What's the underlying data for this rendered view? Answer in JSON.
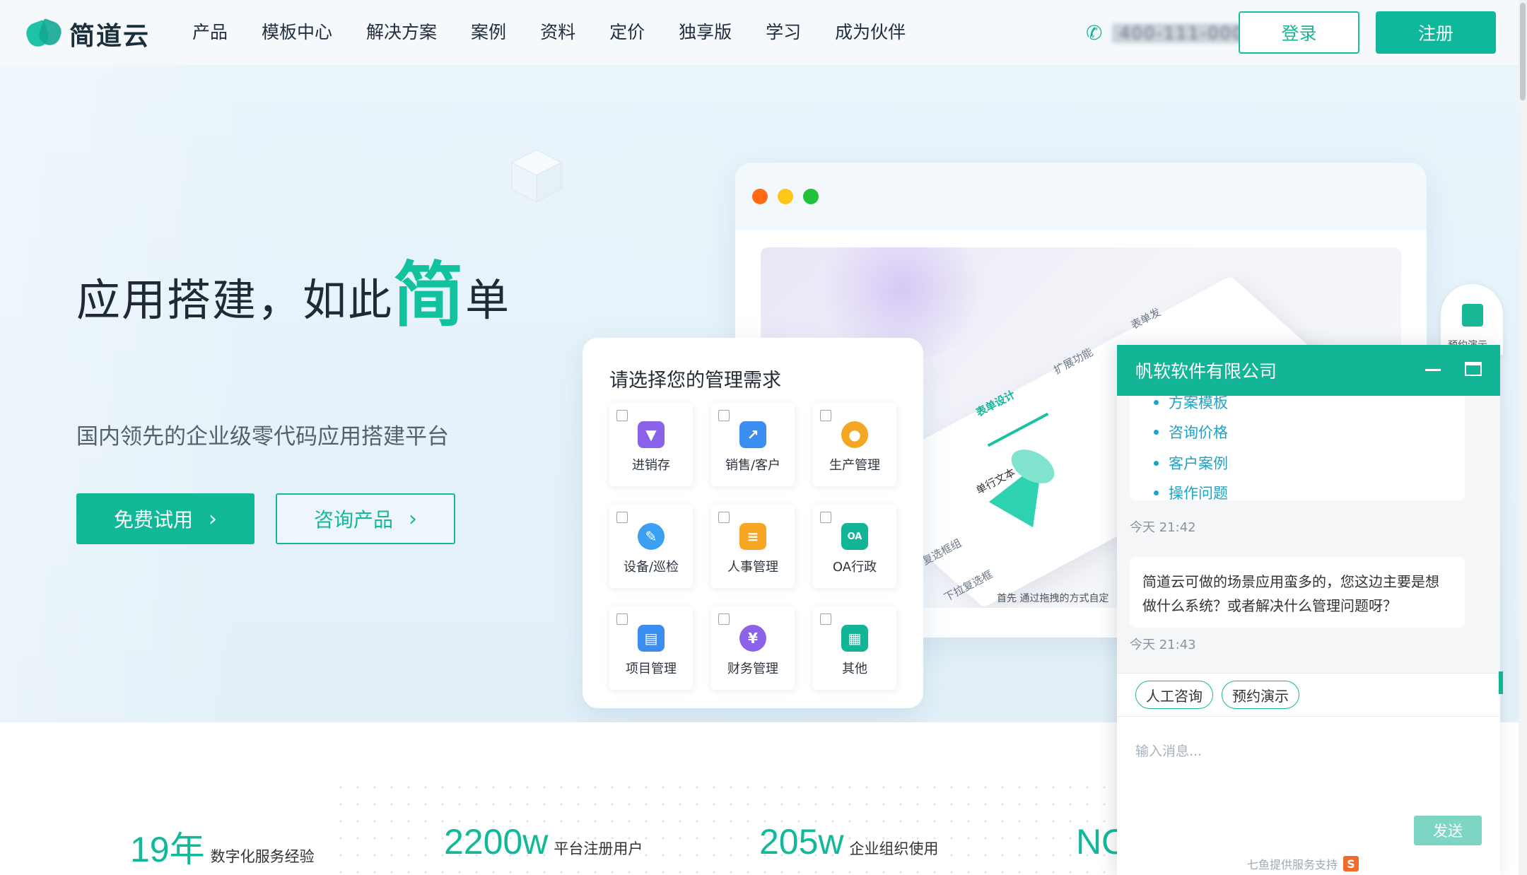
{
  "brand": {
    "name": "简道云",
    "color_primary": "#12b999"
  },
  "nav": {
    "menu": [
      "产品",
      "模板中心",
      "解决方案",
      "案例",
      "资料",
      "定价",
      "独享版",
      "学习",
      "成为伙伴"
    ],
    "phone": "400-111-0000",
    "login": "登录",
    "register": "注册"
  },
  "hero": {
    "headline_pre": "应用搭建，如此",
    "headline_big": "简",
    "headline_post": "单",
    "subline": "国内领先的企业级零代码应用搭建平台",
    "btn_trial": "免费试用",
    "btn_consult": "咨询产品"
  },
  "mock": {
    "traffic_colors": [
      "#ff6a13",
      "#ffc61a",
      "#21c23b"
    ],
    "tabs": [
      "表单设计",
      "扩展功能",
      "表单发"
    ],
    "fields": [
      "单行文本",
      "复选框组",
      "下拉复选框"
    ],
    "caption": "首先 通过拖拽的方式自定"
  },
  "demand": {
    "title": "请选择您的管理需求",
    "options": [
      {
        "label": "进销存",
        "icon": "cart-icon",
        "color": "#8b63e8"
      },
      {
        "label": "销售/客户",
        "icon": "chart-icon",
        "color": "#3b8ef0"
      },
      {
        "label": "生产管理",
        "icon": "factory-icon",
        "color": "#f5a623"
      },
      {
        "label": "设备/巡检",
        "icon": "wrench-icon",
        "color": "#3ba0f2"
      },
      {
        "label": "人事管理",
        "icon": "people-icon",
        "color": "#f5a623"
      },
      {
        "label": "OA行政",
        "icon": "oa-icon",
        "color": "#13b596"
      },
      {
        "label": "项目管理",
        "icon": "folder-icon",
        "color": "#3b8ef0"
      },
      {
        "label": "财务管理",
        "icon": "coin-icon",
        "color": "#8b63e8"
      },
      {
        "label": "其他",
        "icon": "grid-icon",
        "color": "#13b596"
      }
    ]
  },
  "stats": [
    {
      "num": "19年",
      "text": "数字化服务经验"
    },
    {
      "num": "2200w",
      "text": "平台注册用户"
    },
    {
      "num": "205w",
      "text": "企业组织使用"
    },
    {
      "num": "NO",
      "text": ""
    }
  ],
  "chat": {
    "title": "帆软软件有限公司",
    "links": [
      "方案模板",
      "咨询价格",
      "客户案例",
      "操作问题"
    ],
    "ts1": "今天 21:42",
    "message": "简道云可做的场景应用蛮多的，您这边主要是想做什么系统？或者解决什么管理问题呀？",
    "ts2": "今天 21:43",
    "quick": [
      "人工咨询",
      "预约演示"
    ],
    "placeholder": "输入消息...",
    "send": "发送",
    "powered": "七鱼提供服务支持"
  },
  "side": {
    "label": "预约演示"
  }
}
